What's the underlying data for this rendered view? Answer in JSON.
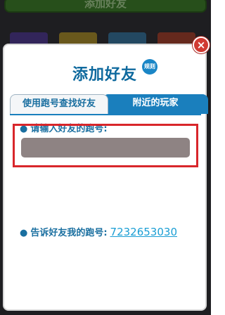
{
  "background": {
    "top_button_label": "添加好友",
    "tile_colors": [
      "#5a3fa8",
      "#c9a52a",
      "#3a86b8",
      "#c2452c"
    ]
  },
  "dialog": {
    "title": "添加好友",
    "rules_badge": "规则",
    "close_glyph": "×",
    "tabs": [
      {
        "label": "使用跑号查找好友",
        "active": true
      },
      {
        "label": "附近的玩家",
        "active": false
      }
    ],
    "search": {
      "label": "请输入好友的跑号:",
      "value": "",
      "placeholder": ""
    },
    "my_id": {
      "label": "告诉好友我的跑号:",
      "value": "7232653030"
    }
  },
  "colors": {
    "accent_blue": "#1a7fbd",
    "highlight_red": "#d8262b",
    "close_red": "#d13a32",
    "link_blue": "#1a9ed4"
  },
  "icons": {
    "close": "close-icon",
    "rules": "rules-icon"
  }
}
